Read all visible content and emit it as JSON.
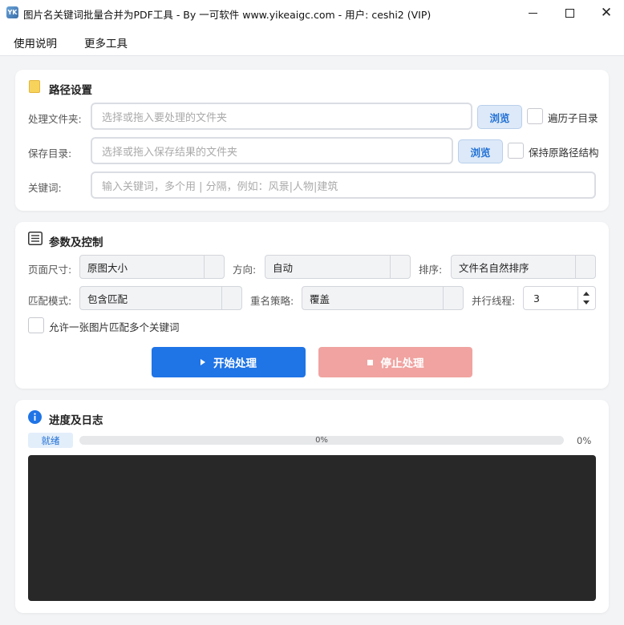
{
  "window": {
    "title": "图片名关键词批量合并为PDF工具 - By 一可软件 www.yikeaigc.com - 用户: ceshi2 (VIP)",
    "app_icon_text": "YK"
  },
  "menu": {
    "items": [
      "使用说明",
      "更多工具"
    ]
  },
  "path_settings": {
    "title": "路径设置",
    "process_folder": {
      "label": "处理文件夹:",
      "placeholder": "选择或拖入要处理的文件夹",
      "browse": "浏览",
      "checkbox_label": "遍历子目录",
      "checked": false
    },
    "save_dir": {
      "label": "保存目录:",
      "placeholder": "选择或拖入保存结果的文件夹",
      "browse": "浏览",
      "checkbox_label": "保持原路径结构",
      "checked": false
    },
    "keywords": {
      "label": "关键词:",
      "placeholder": "输入关键词，多个用 | 分隔，例如：风景|人物|建筑"
    }
  },
  "params": {
    "title": "参数及控制",
    "page_size": {
      "label": "页面尺寸:",
      "value": "原图大小"
    },
    "orientation": {
      "label": "方向:",
      "value": "自动"
    },
    "sort": {
      "label": "排序:",
      "value": "文件名自然排序"
    },
    "match_mode": {
      "label": "匹配模式:",
      "value": "包含匹配"
    },
    "rename_policy": {
      "label": "重名策略:",
      "value": "覆盖"
    },
    "threads": {
      "label": "并行线程:",
      "value": "3"
    },
    "multi_match": {
      "label": "允许一张图片匹配多个关键词",
      "checked": false
    },
    "start_button": "开始处理",
    "stop_button": "停止处理"
  },
  "log": {
    "title": "进度及日志",
    "status": "就绪",
    "progress": 0,
    "progress_text": "0%",
    "progress_pct": "0%"
  },
  "colors": {
    "accent": "#1f74e6",
    "stop": "#f0a3a0",
    "log_bg": "#282828"
  }
}
